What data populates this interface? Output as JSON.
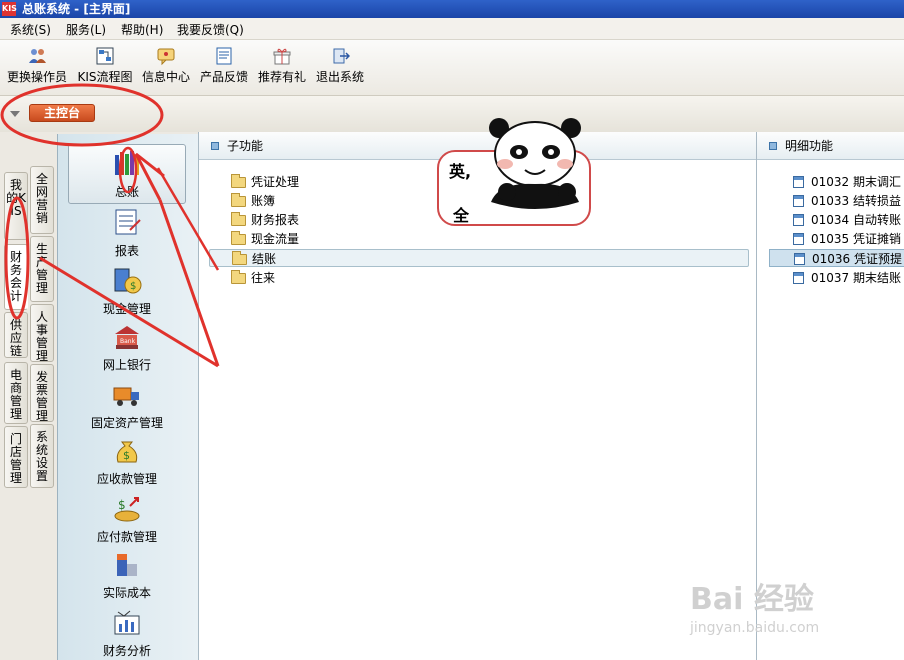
{
  "window": {
    "logo": "KIS",
    "title": "总账系统 - [主界面]"
  },
  "menu": [
    {
      "label": "系统(S)"
    },
    {
      "label": "服务(L)"
    },
    {
      "label": "帮助(H)"
    },
    {
      "label": "我要反馈(Q)"
    }
  ],
  "toolbar": [
    {
      "label": "更换操作员",
      "icon": "users-icon"
    },
    {
      "label": "KIS流程图",
      "icon": "flowchart-icon"
    },
    {
      "label": "信息中心",
      "icon": "message-icon"
    },
    {
      "label": "产品反馈",
      "icon": "feedback-icon"
    },
    {
      "label": "推荐有礼",
      "icon": "gift-icon"
    },
    {
      "label": "退出系统",
      "icon": "exit-icon"
    }
  ],
  "main_tab": "主控台",
  "vertical_tabs": [
    {
      "label": "我的KIS"
    },
    {
      "label": "全网营销"
    },
    {
      "label": "财务会计"
    },
    {
      "label": "生产管理"
    },
    {
      "label": "供应链"
    },
    {
      "label": "人事管理"
    },
    {
      "label": "电商管理"
    },
    {
      "label": "发票管理"
    },
    {
      "label": "门店管理"
    },
    {
      "label": "系统设置"
    }
  ],
  "modules": [
    {
      "label": "总账",
      "icon": "ledger-books-icon"
    },
    {
      "label": "报表",
      "icon": "report-icon"
    },
    {
      "label": "现金管理",
      "icon": "cash-calculator-icon"
    },
    {
      "label": "网上银行",
      "icon": "bank-icon"
    },
    {
      "label": "固定资产管理",
      "icon": "truck-icon"
    },
    {
      "label": "应收款管理",
      "icon": "money-bag-icon"
    },
    {
      "label": "应付款管理",
      "icon": "payment-icon"
    },
    {
      "label": "实际成本",
      "icon": "cost-cube-icon"
    },
    {
      "label": "财务分析",
      "icon": "analysis-icon"
    }
  ],
  "sub_panel": {
    "title": "子功能",
    "items": [
      {
        "label": "凭证处理"
      },
      {
        "label": "账簿"
      },
      {
        "label": "财务报表"
      },
      {
        "label": "现金流量"
      },
      {
        "label": "结账"
      },
      {
        "label": "往来"
      }
    ],
    "selected_index": 4
  },
  "detail_panel": {
    "title": "明细功能",
    "items": [
      {
        "code": "01032",
        "name": "期末调汇"
      },
      {
        "code": "01033",
        "name": "结转损益"
      },
      {
        "code": "01034",
        "name": "自动转账"
      },
      {
        "code": "01035",
        "name": "凭证摊销"
      },
      {
        "code": "01036",
        "name": "凭证预提"
      },
      {
        "code": "01037",
        "name": "期末结账"
      }
    ],
    "selected_index": 4
  },
  "sticker": {
    "text1": "英,",
    "text2": "全"
  },
  "watermark": {
    "text": "Bai 经验",
    "url": "jingyan.baidu.com"
  },
  "colors": {
    "annotation_red": "#e0322c",
    "title_bar": "#2a58c0",
    "main_tab": "#d85a2a"
  }
}
